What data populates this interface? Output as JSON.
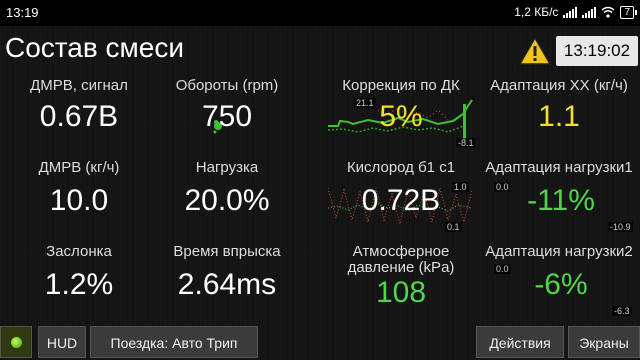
{
  "status": {
    "time": "13:19",
    "speed": "1,2 КБ/с",
    "battery": "7"
  },
  "header": {
    "title": "Состав смеси",
    "clock": "13:19:02"
  },
  "gauges": [
    {
      "label": "ДМРВ, сигнал",
      "value": "0.67В"
    },
    {
      "label": "Обороты (rpm)",
      "value": "750"
    },
    {
      "label": "Коррекция по ДК",
      "value": "5%",
      "max": "21.1",
      "min": "-8.1"
    },
    {
      "label": "Адаптация ХХ (кг/ч)",
      "value": "1.1"
    },
    {
      "label": "ДМРВ (кг/ч)",
      "value": "10.0"
    },
    {
      "label": "Нагрузка",
      "value": "20.0%"
    },
    {
      "label": "Кислород б1 с1",
      "value": "0.72В",
      "max": "1.0",
      "min": "0.1"
    },
    {
      "label": "Адаптация нагрузки1",
      "value": "-11%",
      "max": "0.0",
      "min": "-10.9"
    },
    {
      "label": "Заслонка",
      "value": "1.2%"
    },
    {
      "label": "Время впрыска",
      "value": "2.64ms"
    },
    {
      "label": "Атмосферное давление (kPa)",
      "value": "108"
    },
    {
      "label": "Адаптация нагрузки2",
      "value": "-6%",
      "max": "0.0",
      "min": "-6.3"
    }
  ],
  "toolbar": {
    "hud": "HUD",
    "trip": "Поездка: Авто Трип",
    "actions": "Действия",
    "screens": "Экраны"
  },
  "colors": {
    "yellow": "#f2e12a",
    "green": "#4fd64a"
  },
  "icons": [
    "signal-icon",
    "wifi-icon",
    "battery-icon",
    "warning-icon",
    "status-led-icon"
  ]
}
